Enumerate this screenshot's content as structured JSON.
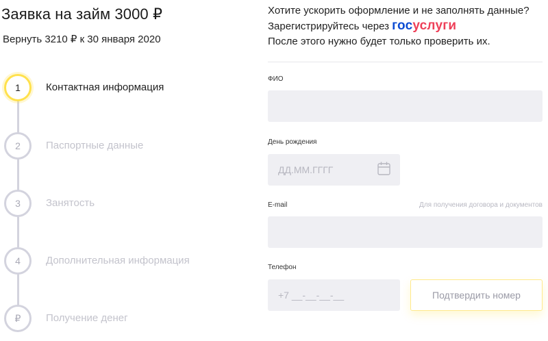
{
  "header": {
    "title": "Заявка на займ 3000 ₽",
    "subtitle": "Вернуть 3210 ₽ к 30 января 2020"
  },
  "steps": [
    {
      "number": "1",
      "label": "Контактная информация",
      "active": true
    },
    {
      "number": "2",
      "label": "Паспортные данные",
      "active": false
    },
    {
      "number": "3",
      "label": "Занятость",
      "active": false
    },
    {
      "number": "4",
      "label": "Дополнительная информация",
      "active": false
    },
    {
      "number": "₽",
      "label": "Получение денег",
      "active": false
    }
  ],
  "gosuslugi": {
    "line1": "Хотите ускорить оформление и не заполнять данные?",
    "line2_prefix": "Зарегистрируйтесь через",
    "brand_part1": "гос",
    "brand_part2": "услуги",
    "line3": "После этого нужно будет только проверить их."
  },
  "form": {
    "fio": {
      "label": "ФИО",
      "value": ""
    },
    "birthday": {
      "label": "День рождения",
      "placeholder": "ДД.ММ.ГГГГ",
      "icon": "calendar-icon"
    },
    "email": {
      "label": "E-mail",
      "hint": "Для получения договора и документов",
      "value": ""
    },
    "phone": {
      "label": "Телефон",
      "placeholder": "+7 __-__-__-__"
    },
    "confirm_button": "Подтвердить номер"
  },
  "colors": {
    "active_step": "#ffe14d",
    "inactive_step": "#d3d3de",
    "gos_blue": "#0d4cd3",
    "gos_red": "#ee3f58",
    "input_bg": "#efeff3"
  }
}
